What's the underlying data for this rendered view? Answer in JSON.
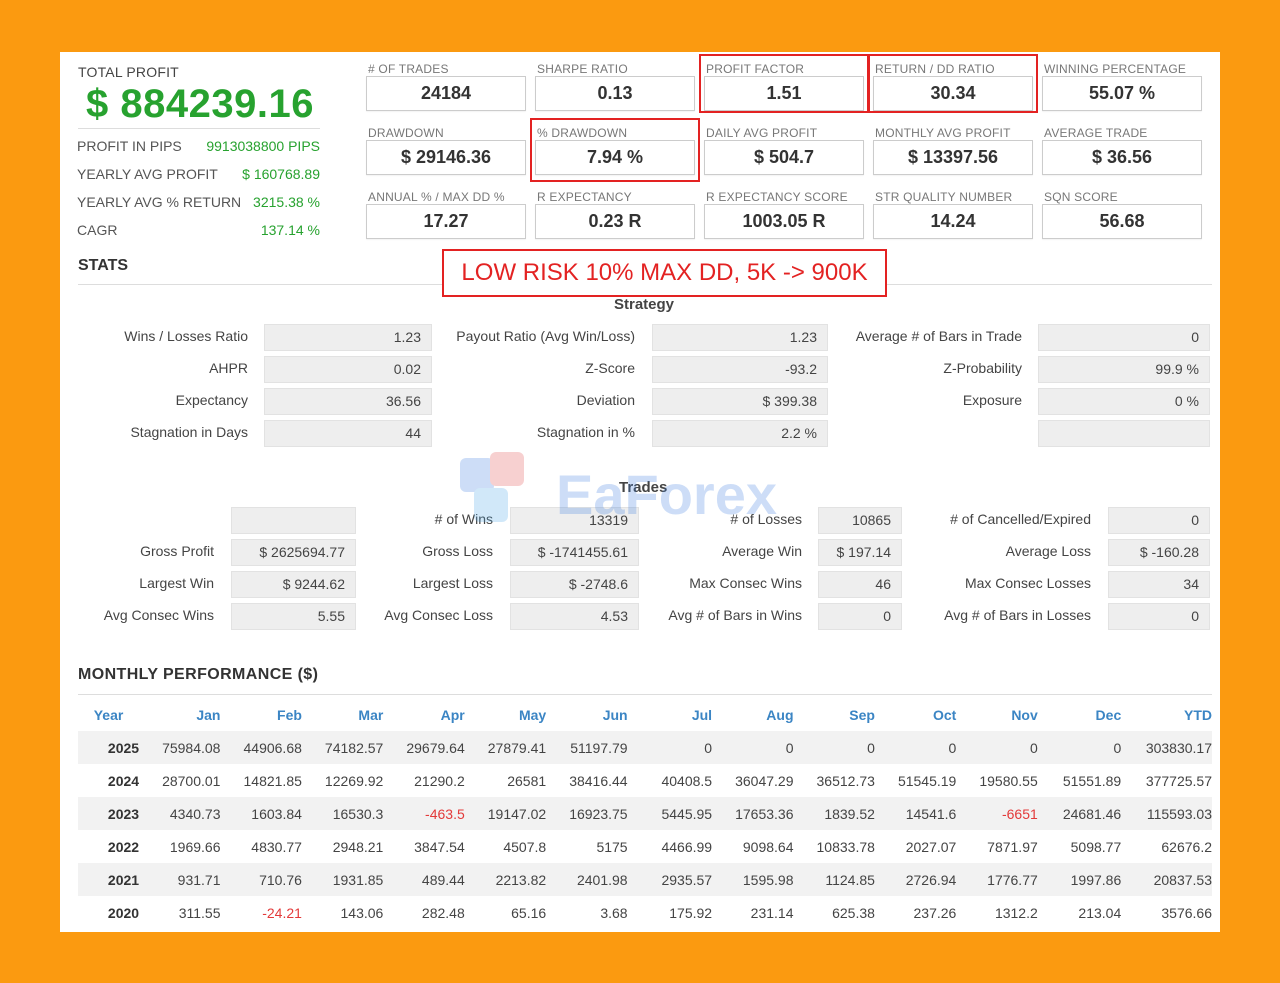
{
  "profit": {
    "total_label": "TOTAL PROFIT",
    "total_value": "$ 884239.16",
    "rows": [
      {
        "label": "PROFIT IN PIPS",
        "value": "9913038800 PIPS"
      },
      {
        "label": "YEARLY AVG PROFIT",
        "value": "$ 160768.89"
      },
      {
        "label": "YEARLY AVG % RETURN",
        "value": "3215.38 %"
      },
      {
        "label": "CAGR",
        "value": "137.14 %"
      }
    ]
  },
  "metrics": [
    {
      "label": "# OF TRADES",
      "value": "24184",
      "highlight": false
    },
    {
      "label": "SHARPE RATIO",
      "value": "0.13",
      "highlight": false
    },
    {
      "label": "PROFIT FACTOR",
      "value": "1.51",
      "highlight": true
    },
    {
      "label": "RETURN / DD RATIO",
      "value": "30.34",
      "highlight": true
    },
    {
      "label": "WINNING PERCENTAGE",
      "value": "55.07 %",
      "highlight": false
    },
    {
      "label": "DRAWDOWN",
      "value": "$ 29146.36",
      "highlight": false
    },
    {
      "label": "% DRAWDOWN",
      "value": "7.94 %",
      "highlight": true
    },
    {
      "label": "DAILY AVG PROFIT",
      "value": "$ 504.7",
      "highlight": false
    },
    {
      "label": "MONTHLY AVG PROFIT",
      "value": "$ 13397.56",
      "highlight": false
    },
    {
      "label": "AVERAGE TRADE",
      "value": "$ 36.56",
      "highlight": false
    },
    {
      "label": "ANNUAL % / MAX DD %",
      "value": "17.27",
      "highlight": false
    },
    {
      "label": "R EXPECTANCY",
      "value": "0.23 R",
      "highlight": false
    },
    {
      "label": "R EXPECTANCY SCORE",
      "value": "1003.05 R",
      "highlight": false
    },
    {
      "label": "STR QUALITY NUMBER",
      "value": "14.24",
      "highlight": false
    },
    {
      "label": "SQN SCORE",
      "value": "56.68",
      "highlight": false
    }
  ],
  "stats_title": "STATS",
  "banner": "LOW RISK 10% MAX DD, 5K -> 900K",
  "strategy": {
    "title": "Strategy",
    "rows": [
      [
        {
          "label": "Wins / Losses Ratio",
          "value": "1.23"
        },
        {
          "label": "Payout Ratio (Avg Win/Loss)",
          "value": "1.23"
        },
        {
          "label": "Average # of Bars in Trade",
          "value": "0"
        }
      ],
      [
        {
          "label": "AHPR",
          "value": "0.02"
        },
        {
          "label": "Z-Score",
          "value": "-93.2"
        },
        {
          "label": "Z-Probability",
          "value": "99.9 %"
        }
      ],
      [
        {
          "label": "Expectancy",
          "value": "36.56"
        },
        {
          "label": "Deviation",
          "value": "$ 399.38"
        },
        {
          "label": "Exposure",
          "value": "0 %"
        }
      ],
      [
        {
          "label": "Stagnation in Days",
          "value": "44"
        },
        {
          "label": "Stagnation in %",
          "value": "2.2 %"
        },
        {
          "label": "",
          "value": ""
        }
      ]
    ]
  },
  "trades": {
    "title": "Trades",
    "rows": [
      [
        {
          "label": "",
          "value": ""
        },
        {
          "label": "# of Wins",
          "value": "13319"
        },
        {
          "label": "# of Losses",
          "value": "10865"
        },
        {
          "label": "# of Cancelled/Expired",
          "value": "0"
        }
      ],
      [
        {
          "label": "Gross Profit",
          "value": "$ 2625694.77"
        },
        {
          "label": "Gross Loss",
          "value": "$ -1741455.61"
        },
        {
          "label": "Average Win",
          "value": "$ 197.14"
        },
        {
          "label": "Average Loss",
          "value": "$ -160.28"
        }
      ],
      [
        {
          "label": "Largest Win",
          "value": "$ 9244.62"
        },
        {
          "label": "Largest Loss",
          "value": "$ -2748.6"
        },
        {
          "label": "Max Consec Wins",
          "value": "46"
        },
        {
          "label": "Max Consec Losses",
          "value": "34"
        }
      ],
      [
        {
          "label": "Avg Consec Wins",
          "value": "5.55"
        },
        {
          "label": "Avg Consec Loss",
          "value": "4.53"
        },
        {
          "label": "Avg # of Bars in Wins",
          "value": "0"
        },
        {
          "label": "Avg # of Bars in Losses",
          "value": "0"
        }
      ]
    ]
  },
  "monthly": {
    "title": "MONTHLY PERFORMANCE ($)",
    "headers": [
      "Year",
      "Jan",
      "Feb",
      "Mar",
      "Apr",
      "May",
      "Jun",
      "Jul",
      "Aug",
      "Sep",
      "Oct",
      "Nov",
      "Dec",
      "YTD"
    ],
    "rows": [
      [
        "2025",
        "75984.08",
        "44906.68",
        "74182.57",
        "29679.64",
        "27879.41",
        "51197.79",
        "0",
        "0",
        "0",
        "0",
        "0",
        "0",
        "303830.17"
      ],
      [
        "2024",
        "28700.01",
        "14821.85",
        "12269.92",
        "21290.2",
        "26581",
        "38416.44",
        "40408.5",
        "36047.29",
        "36512.73",
        "51545.19",
        "19580.55",
        "51551.89",
        "377725.57"
      ],
      [
        "2023",
        "4340.73",
        "1603.84",
        "16530.3",
        "-463.5",
        "19147.02",
        "16923.75",
        "5445.95",
        "17653.36",
        "1839.52",
        "14541.6",
        "-6651",
        "24681.46",
        "115593.03"
      ],
      [
        "2022",
        "1969.66",
        "4830.77",
        "2948.21",
        "3847.54",
        "4507.8",
        "5175",
        "4466.99",
        "9098.64",
        "10833.78",
        "2027.07",
        "7871.97",
        "5098.77",
        "62676.2"
      ],
      [
        "2021",
        "931.71",
        "710.76",
        "1931.85",
        "489.44",
        "2213.82",
        "2401.98",
        "2935.57",
        "1595.98",
        "1124.85",
        "2726.94",
        "1776.77",
        "1997.86",
        "20837.53"
      ],
      [
        "2020",
        "311.55",
        "-24.21",
        "143.06",
        "282.48",
        "65.16",
        "3.68",
        "175.92",
        "231.14",
        "625.38",
        "237.26",
        "1312.2",
        "213.04",
        "3576.66"
      ]
    ]
  },
  "watermark": "EaForex"
}
